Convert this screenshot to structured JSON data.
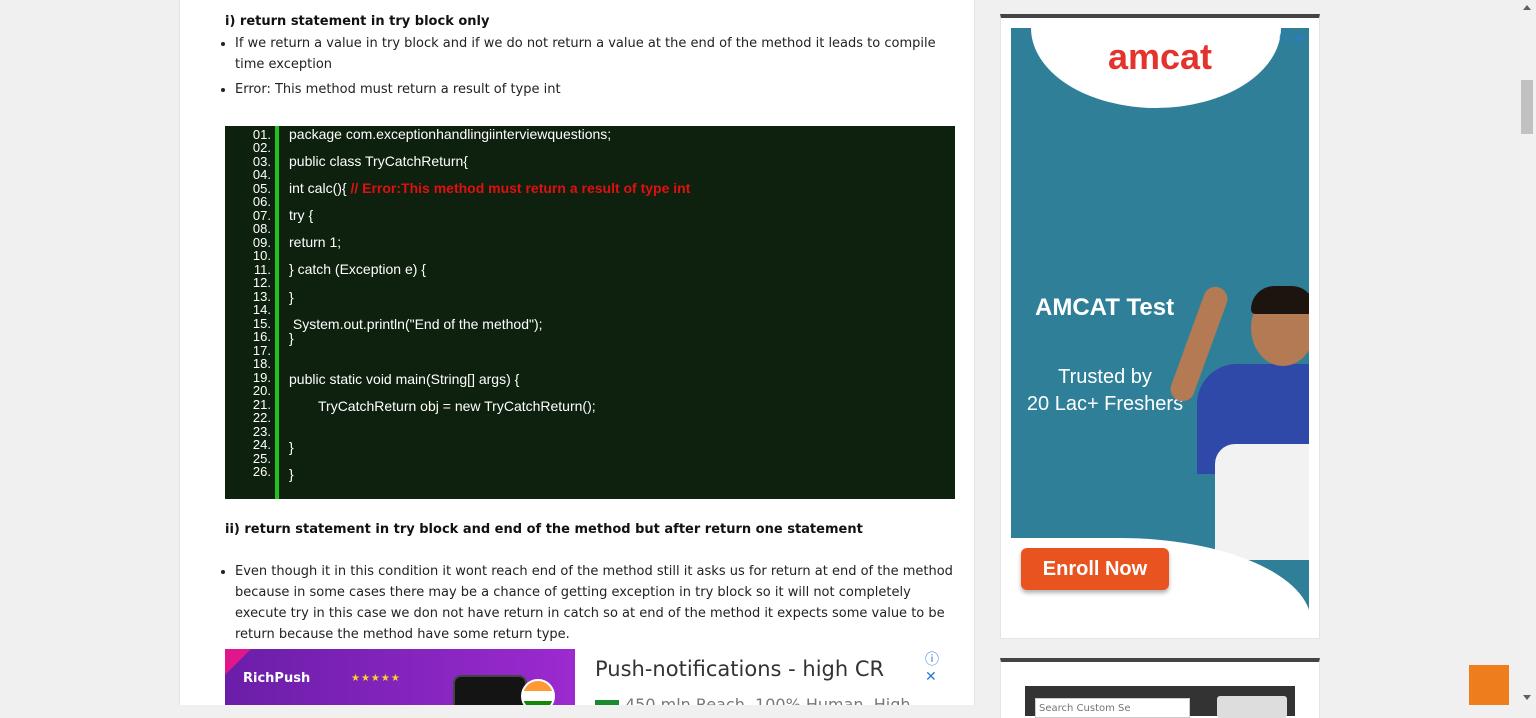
{
  "article": {
    "heading1": "i) return statement in try block only",
    "bullets1": [
      "If we return a value in try block and if we do not return a value at the end of the method it leads to compile time exception",
      "Error: This method must return a result of type int"
    ],
    "code": {
      "line_numbers": [
        "01.",
        "02.",
        "03.",
        "04.",
        "05.",
        "06.",
        "07.",
        "08.",
        "09.",
        "10.",
        "11.",
        "12.",
        "13.",
        "14.",
        "15.",
        "16.",
        "17.",
        "18.",
        "19.",
        "20.",
        "21.",
        "22.",
        "23.",
        "24.",
        "25.",
        "26."
      ],
      "lines": [
        {
          "text": "package com.exceptionhandlingiinterviewquestions;"
        },
        {
          "text": "public class TryCatchReturn{"
        },
        {
          "text": "int calc(){ ",
          "comment": "// Error:This method must return a result of type int"
        },
        {
          "text": "try {"
        },
        {
          "text": "return 1;"
        },
        {
          "text": "} catch (Exception e) {"
        },
        {
          "text": "}"
        },
        {
          "text": " System.out.println(\"End of the method\");"
        },
        {
          "text": "}"
        },
        {
          "text": "public static void main(String[] args) {"
        },
        {
          "text": "TryCatchReturn obj = new TryCatchReturn();"
        },
        {
          "text": "}"
        },
        {
          "text": "}"
        }
      ]
    },
    "heading2": "ii) return statement in try block and end of the method but after return one statement",
    "bullets2": [
      "Even though it in this condition it wont reach end of the method still it asks us for return at end of the method because in some cases there may be a chance of getting exception in try block so it will not completely execute try in this case we don not have return in catch so at end of the method it expects some value to be return because the  method have some return type."
    ]
  },
  "bottom_ad": {
    "brand": "RichPush",
    "stars": "★★★★★",
    "title": "Push-notifications - high CR",
    "subtitle": "450 mln Reach, 100% Human, High",
    "controls": "ⓘ ✕"
  },
  "sidebar_ad": {
    "logo": "amcat",
    "controls": "ⓘ✕",
    "title": "AMCAT Test",
    "tagline_1": "Trusted by",
    "tagline_2": "20 Lac+ Freshers",
    "button": "Enroll Now"
  },
  "sidebar_search": {
    "placeholder": "Search Custom Se"
  }
}
